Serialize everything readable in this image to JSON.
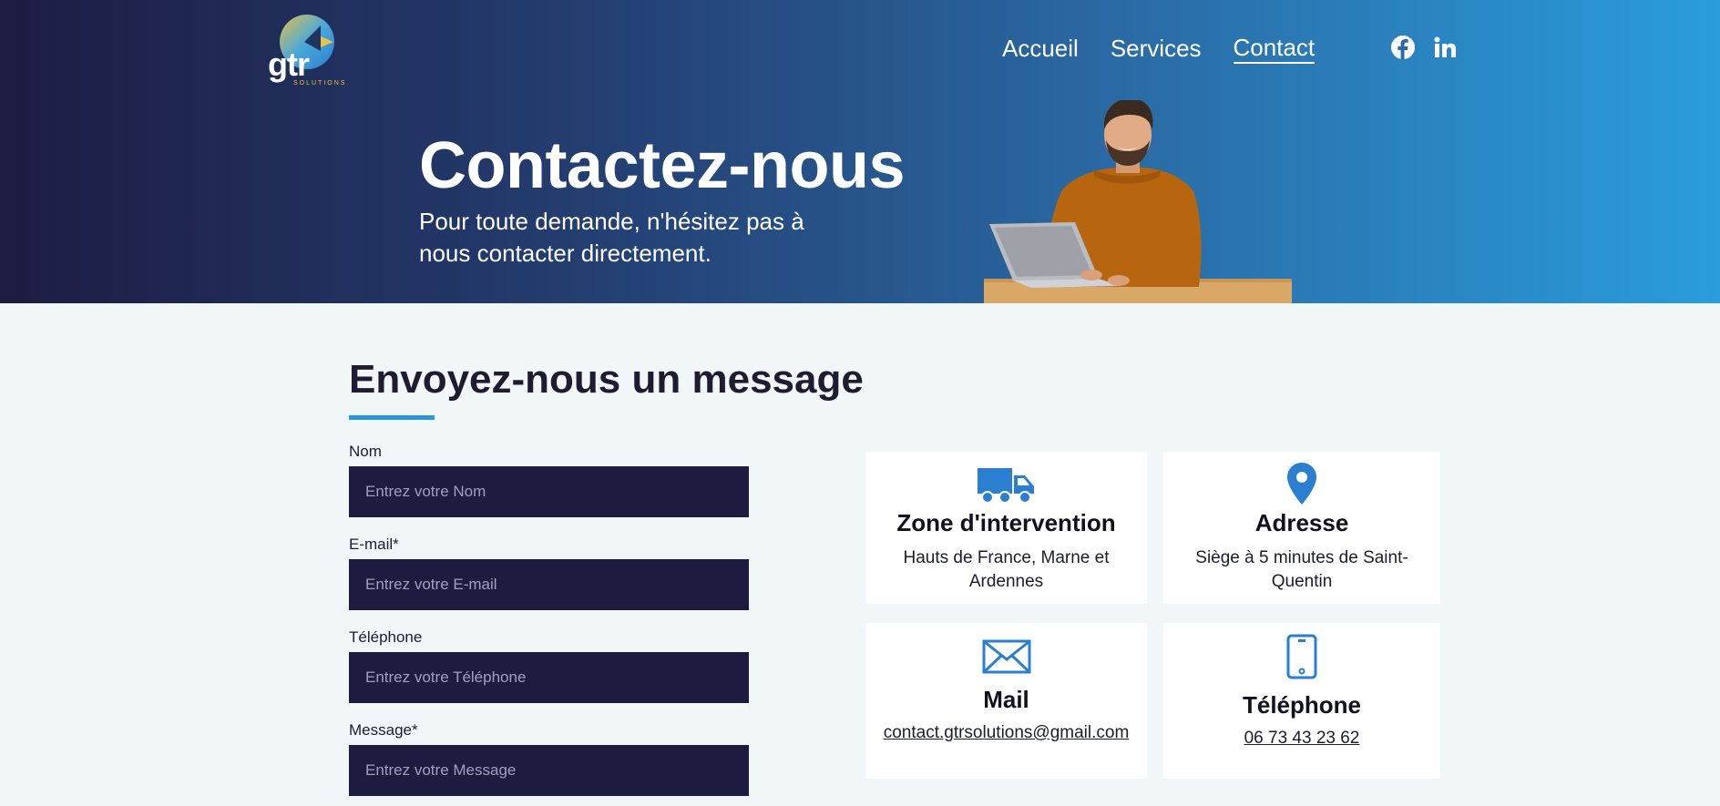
{
  "logo": {
    "text": "gtr",
    "subtext": "SOLUTIONS"
  },
  "nav": {
    "items": [
      "Accueil",
      "Services",
      "Contact"
    ],
    "active": "Contact"
  },
  "social": {
    "icons": [
      "facebook-icon",
      "linkedin-icon"
    ]
  },
  "hero": {
    "title": "Contactez-nous",
    "subtitle": "Pour toute demande, n'hésitez pas à nous contacter directement."
  },
  "form_section": {
    "title": "Envoyez-nous un message",
    "fields": [
      {
        "label": "Nom",
        "placeholder": "Entrez votre Nom"
      },
      {
        "label": "E-mail*",
        "placeholder": "Entrez votre E-mail"
      },
      {
        "label": "Téléphone",
        "placeholder": "Entrez votre Téléphone"
      },
      {
        "label": "Message*",
        "placeholder": "Entrez votre Message"
      }
    ]
  },
  "info_cards": [
    {
      "icon": "truck-icon",
      "title": "Zone d'intervention",
      "text": "Hauts de France, Marne et Ardennes"
    },
    {
      "icon": "map-pin-icon",
      "title": "Adresse",
      "text": "Siège à 5 minutes de Saint-Quentin"
    },
    {
      "icon": "envelope-icon",
      "title": "Mail",
      "link": "contact.gtrsolutions@gmail.com"
    },
    {
      "icon": "phone-icon",
      "title": "Téléphone",
      "link": "06 73 43 23 62"
    }
  ],
  "colors": {
    "accent": "#2a98d8",
    "dark": "#1d1b40",
    "icon": "#2a7fd0"
  }
}
